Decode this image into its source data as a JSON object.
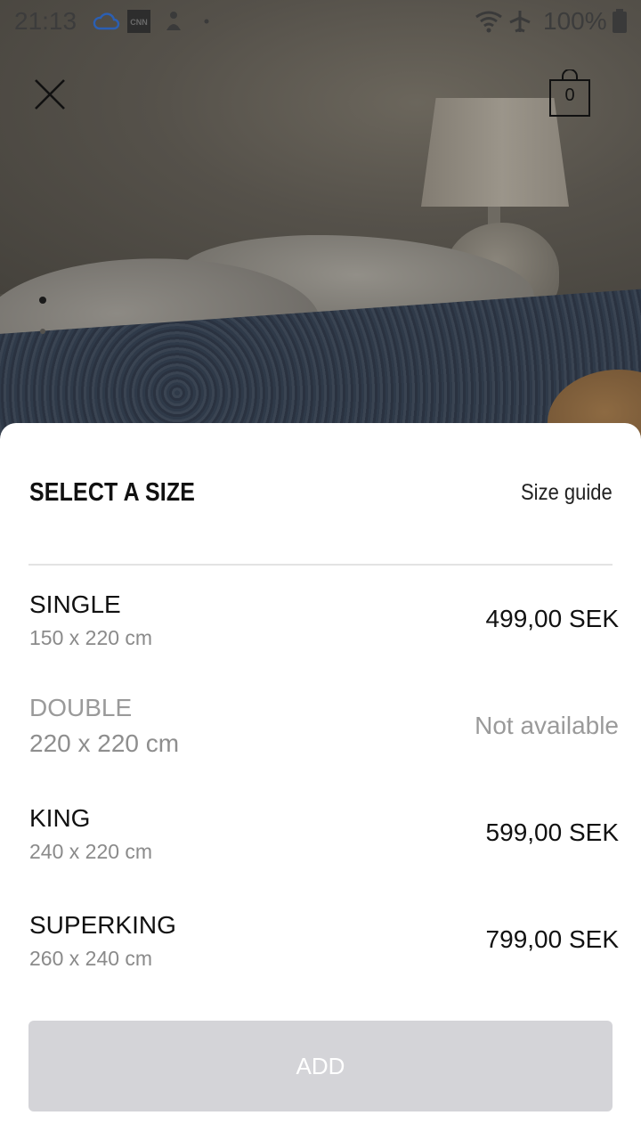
{
  "status_bar": {
    "time": "21:13",
    "battery": "100%",
    "icons": [
      "cloud-icon",
      "cnn-app-icon",
      "notification-app-icon",
      "dot-icon",
      "wifi-icon",
      "airplane-mode-icon",
      "battery-icon"
    ]
  },
  "header": {
    "close_icon": "close-icon",
    "cart_count": "0",
    "cart_icon": "shopping-bag-icon"
  },
  "sheet": {
    "title": "SELECT A SIZE",
    "size_guide": "Size guide",
    "options": [
      {
        "name": "SINGLE",
        "dims": "150 x 220 cm",
        "price": "499,00 SEK",
        "available": true
      },
      {
        "name": "DOUBLE",
        "dims": "220 x 220 cm",
        "price": "Not available",
        "available": false
      },
      {
        "name": "KING",
        "dims": "240 x 220 cm",
        "price": "599,00 SEK",
        "available": true
      },
      {
        "name": "SUPERKING",
        "dims": "260 x 240 cm",
        "price": "799,00 SEK",
        "available": true
      }
    ],
    "add_button": "ADD"
  },
  "colors": {
    "sheet_bg": "#ffffff",
    "add_button_disabled": "#d4d4d8",
    "unavailable_text": "#9a9a9a"
  }
}
